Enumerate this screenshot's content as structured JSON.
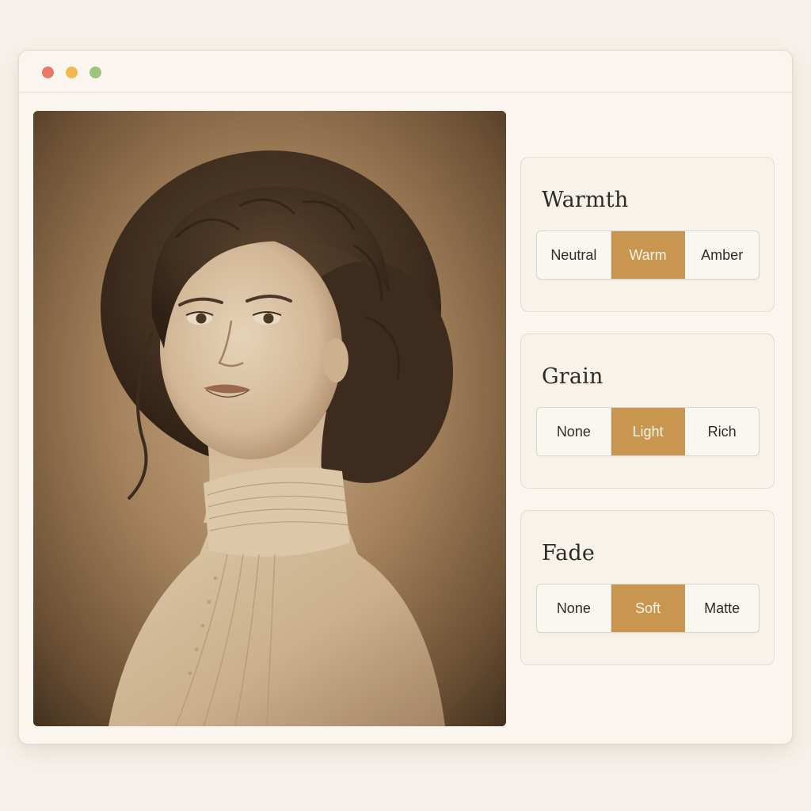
{
  "window": {
    "controls": {
      "close_color": "#e8796a",
      "minimize_color": "#f0bb4c",
      "maximize_color": "#9cc57b"
    }
  },
  "photo": {
    "subject": "sepia portrait of a woman with curled updo and high lace collar",
    "tone": "sepia"
  },
  "panels": [
    {
      "title": "Warmth",
      "options": [
        "Neutral",
        "Warm",
        "Amber"
      ],
      "selected": "Warm"
    },
    {
      "title": "Grain",
      "options": [
        "None",
        "Light",
        "Rich"
      ],
      "selected": "Light"
    },
    {
      "title": "Fade",
      "options": [
        "None",
        "Soft",
        "Matte"
      ],
      "selected": "Soft"
    }
  ],
  "colors": {
    "accent": "#c9964f",
    "background": "#faf6ef",
    "text": "#2e2a25"
  }
}
